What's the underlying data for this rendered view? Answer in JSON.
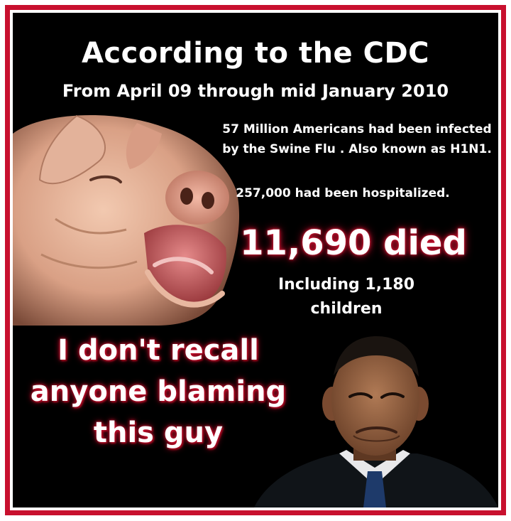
{
  "header": {
    "title": "According to the CDC",
    "subtitle": "From April 09 through mid January 2010"
  },
  "facts": {
    "infected": "57 Million Americans had been infected by the Swine Flu . Also known as H1N1.",
    "hospitalized": "257,000 had been hospitalized.",
    "died": "11,690 died",
    "children": "Including 1,180 children"
  },
  "quote": "I don't recall anyone blaming this guy",
  "colors": {
    "frame": "#c8102e",
    "background": "#000000",
    "text": "#ffffff",
    "glow": "#c8102e"
  }
}
